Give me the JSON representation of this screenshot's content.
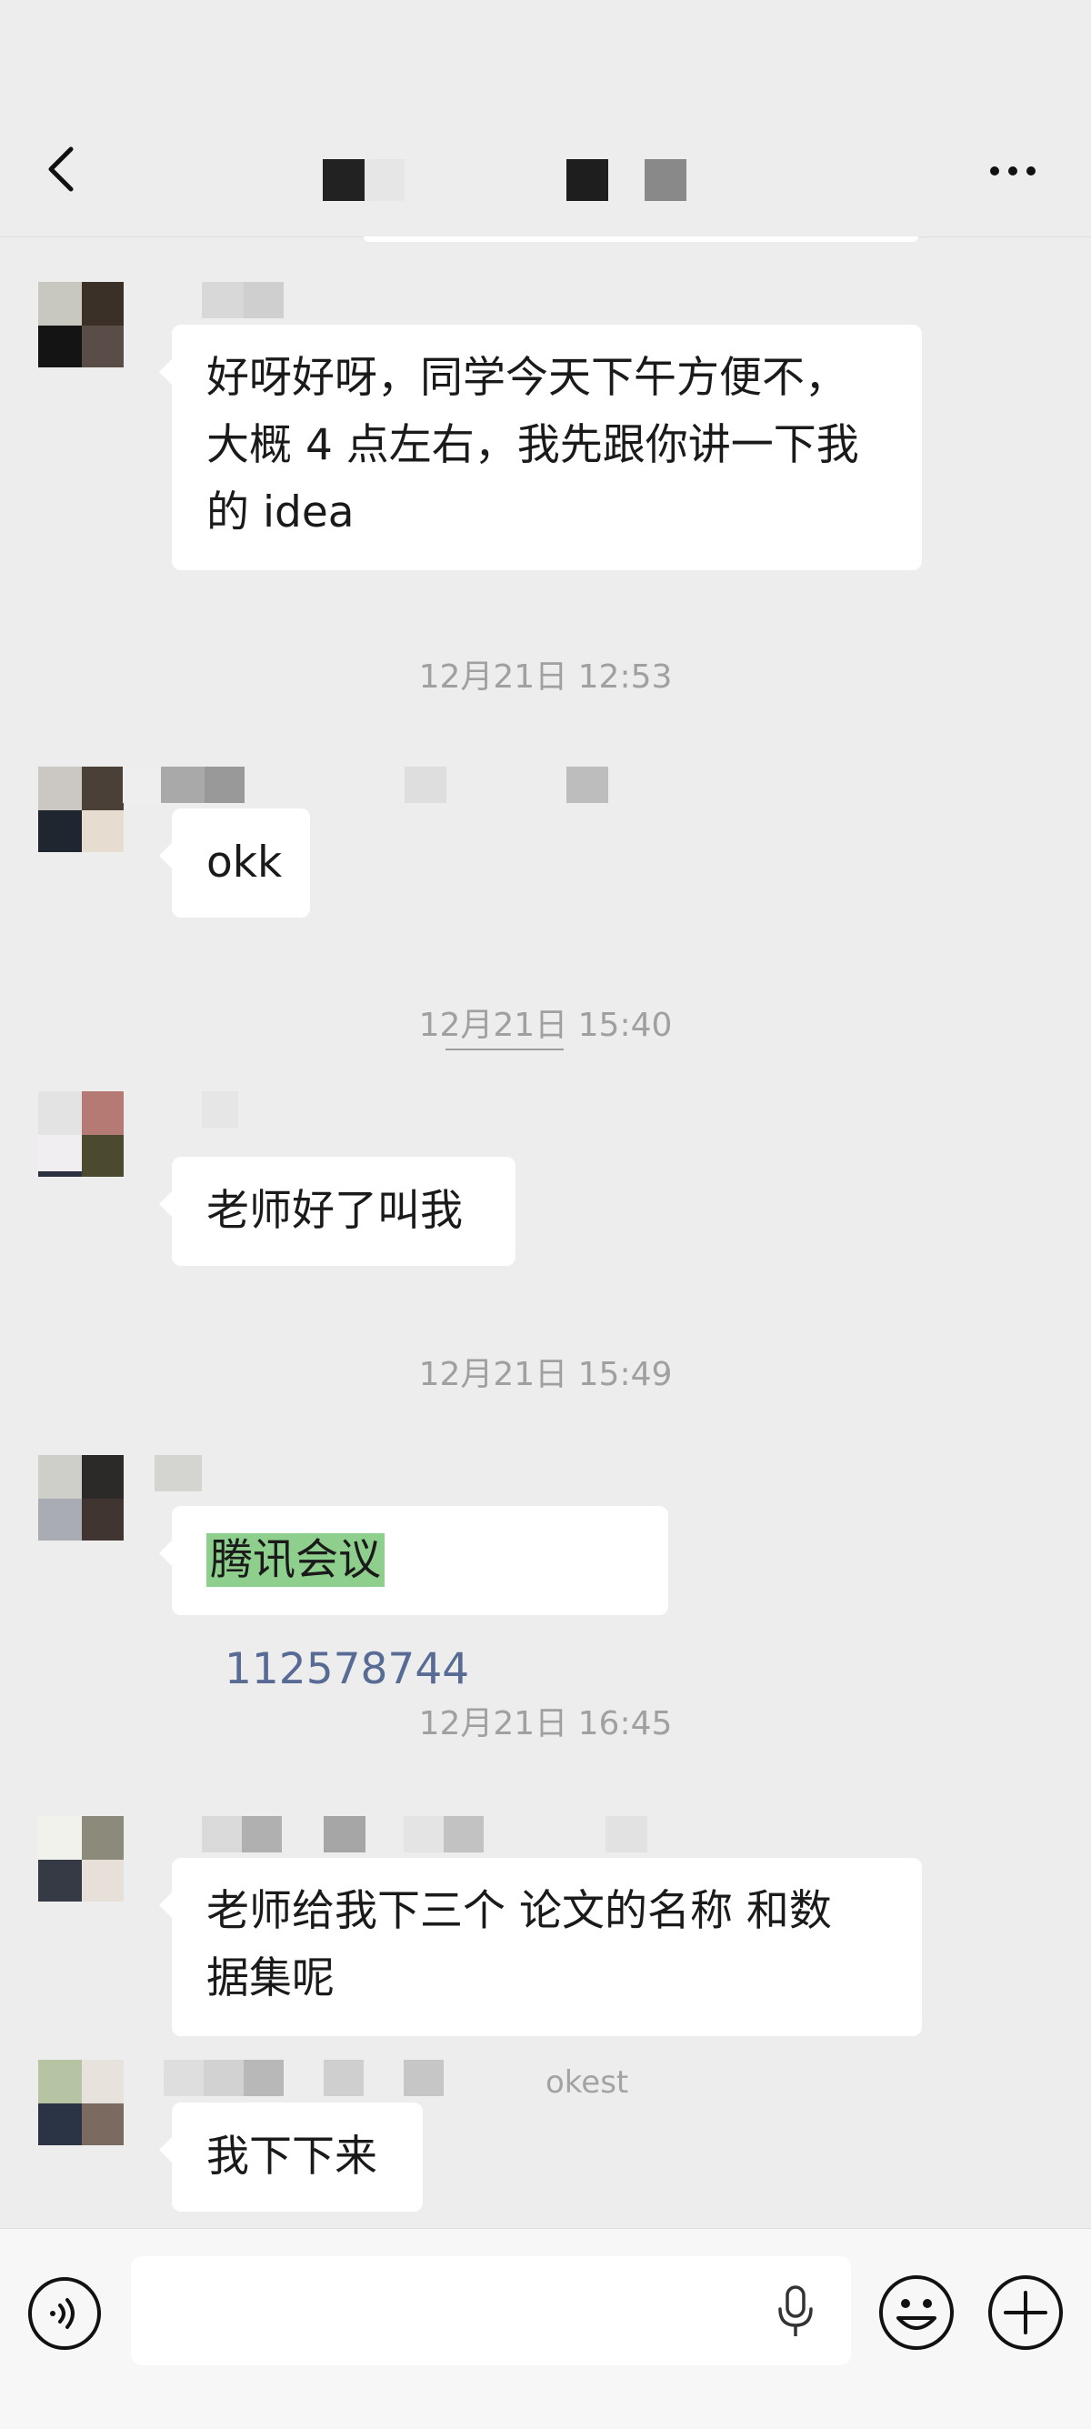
{
  "colors": {
    "background": "#ededed",
    "bubble": "#ffffff",
    "link": "#576b95",
    "highlight": "#8ecf8d",
    "timestamp": "#a0a0a0"
  },
  "header": {
    "back_icon": "chevron-left-icon",
    "more_icon": "ellipsis-icon"
  },
  "messages": [
    {
      "text": "好呀好呀，同学今天下午方便不，",
      "line2": "大概 4 点左右，我先跟你讲一下我",
      "line3": "的 idea"
    },
    {
      "timestamp": "12月21日 12:53",
      "text": "okk"
    },
    {
      "timestamp": "12月21日 15:40",
      "text": "老师好了叫我"
    },
    {
      "timestamp": "12月21日 15:49",
      "app": "腾讯会议",
      "number": "112578744"
    },
    {
      "timestamp": "12月21日 16:45",
      "text": "老师给我下三个 论文的名称 和数",
      "line2": "据集呢"
    },
    {
      "nickname": "okest",
      "text": "我下下来"
    }
  ],
  "bottom": {
    "voice_icon": "voice-toggle-icon",
    "mic_icon": "microphone-icon",
    "emoji_icon": "emoji-icon",
    "plus_icon": "plus-icon",
    "input_value": ""
  }
}
